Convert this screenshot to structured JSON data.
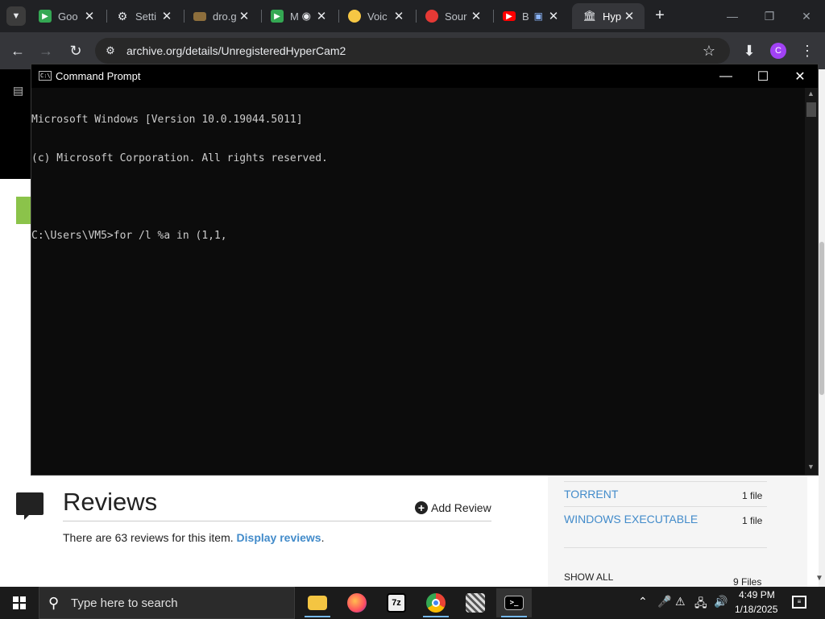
{
  "browser": {
    "tab_list_icon": "chevron-down-icon",
    "tabs": [
      {
        "title": "Goo",
        "icon": "google-meet-icon",
        "color": "#34a853"
      },
      {
        "title": "Setti",
        "icon": "gear-icon",
        "color": "#e8eaed"
      },
      {
        "title": "dro.g",
        "icon": "folder-icon",
        "color": "#8d6e3c"
      },
      {
        "title": "M",
        "icon": "google-meet-icon",
        "color": "#34a853"
      },
      {
        "title": "Voic",
        "icon": "voice-icon",
        "color": "#f6c744"
      },
      {
        "title": "Sour",
        "icon": "soundcloud-icon",
        "color": "#e53935"
      },
      {
        "title": "B",
        "icon": "youtube-icon",
        "color": "#ff0000"
      },
      {
        "title": "Hyp",
        "icon": "archive-icon",
        "color": "#e8eaed"
      }
    ],
    "new_tab_label": "+",
    "url": "archive.org/details/UnregisteredHyperCam2",
    "profile_initial": "C"
  },
  "cmd": {
    "title": "Command Prompt",
    "lines": [
      "Microsoft Windows [Version 10.0.19044.5011]",
      "(c) Microsoft Corporation. All rights reserved.",
      "",
      "C:\\Users\\VM5>for /l %a in (1,1,"
    ]
  },
  "page": {
    "reviews_title": "Reviews",
    "add_review": "Add Review",
    "reviews_text": "There are 63 reviews for this item. ",
    "display_reviews": "Display reviews",
    "period": ".",
    "downloads": [
      {
        "label": "TORRENT",
        "count": "1 file"
      },
      {
        "label": "WINDOWS EXECUTABLE",
        "count": "1 file"
      }
    ],
    "show_all": "SHOW ALL",
    "total_files": "9 Files",
    "link_color": "#428bca"
  },
  "taskbar": {
    "search_placeholder": "Type here to search",
    "apps": [
      {
        "name": "file-explorer",
        "label": ""
      },
      {
        "name": "firefox",
        "label": ""
      },
      {
        "name": "7zip",
        "label": "7z"
      },
      {
        "name": "chrome",
        "label": ""
      },
      {
        "name": "unknown-app",
        "label": ""
      },
      {
        "name": "command-prompt",
        "label": ""
      }
    ],
    "time": "4:49 PM",
    "date": "1/18/2025"
  }
}
